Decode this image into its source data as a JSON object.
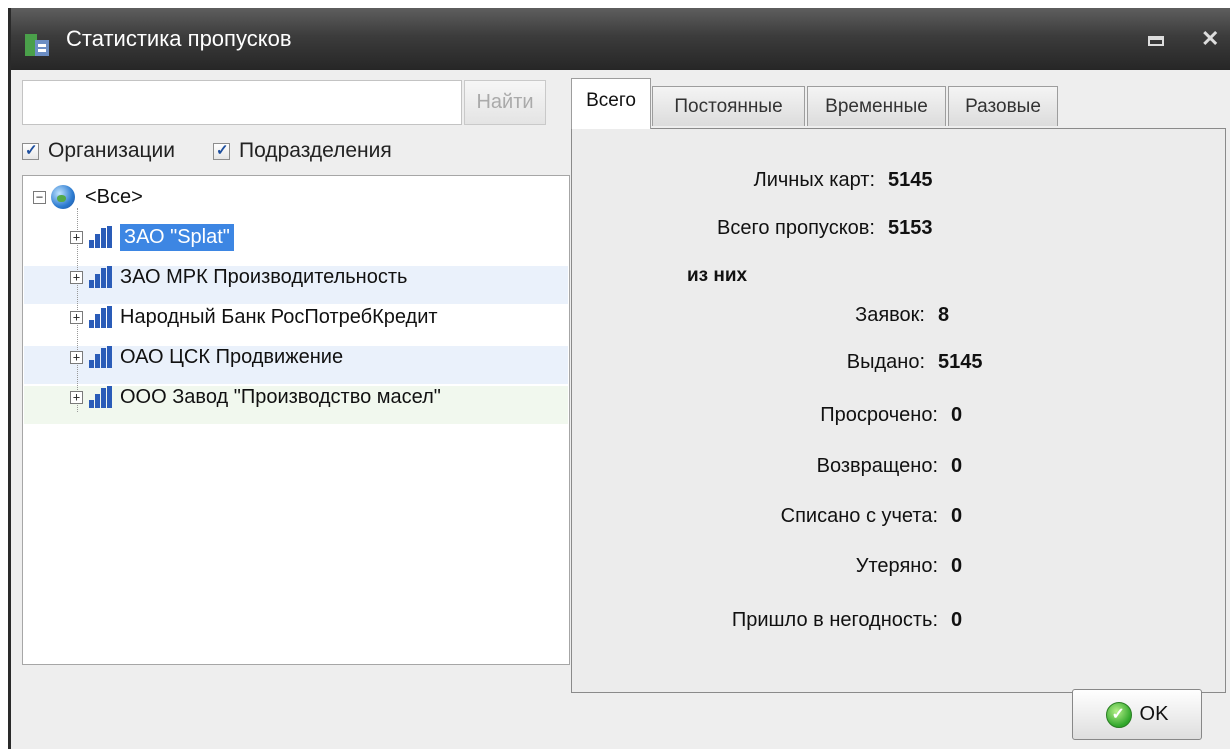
{
  "window": {
    "title": "Статистика пропусков"
  },
  "search": {
    "value": "",
    "placeholder": "",
    "button": "Найти"
  },
  "filters": [
    {
      "label": "Организации",
      "checked": true
    },
    {
      "label": "Подразделения",
      "checked": true
    }
  ],
  "tree": {
    "root": "<Все>",
    "items": [
      {
        "label": "ЗАО \"Splat\"",
        "selected": true
      },
      {
        "label": "ЗАО МРК Производительность",
        "selected": false
      },
      {
        "label": "Народный Банк РосПотребКредит",
        "selected": false
      },
      {
        "label": "ОАО ЦСК Продвижение",
        "selected": false
      },
      {
        "label": "ООО Завод \"Производство масел\"",
        "selected": false
      }
    ]
  },
  "tabs": [
    "Всего",
    "Постоянные",
    "Временные",
    "Разовые"
  ],
  "active_tab": "Всего",
  "stats": {
    "personal_cards": {
      "label": "Личных карт:",
      "value": "5145"
    },
    "total_passes": {
      "label": "Всего пропусков:",
      "value": "5153"
    },
    "of_them": "из них",
    "requests": {
      "label": "Заявок:",
      "value": "8"
    },
    "issued": {
      "label": "Выдано:",
      "value": "5145"
    },
    "expired": {
      "label": "Просрочено:",
      "value": "0"
    },
    "returned": {
      "label": "Возвращено:",
      "value": "0"
    },
    "written_off": {
      "label": "Списано с учета:",
      "value": "0"
    },
    "lost": {
      "label": "Утеряно:",
      "value": "0"
    },
    "unusable": {
      "label": "Пришло в негодность:",
      "value": "0"
    }
  },
  "ok_button": "OK",
  "colors": {
    "selection": "#3d86e3",
    "titlebar": "#3c3c3c",
    "row_alt": "#eaf1fb"
  }
}
